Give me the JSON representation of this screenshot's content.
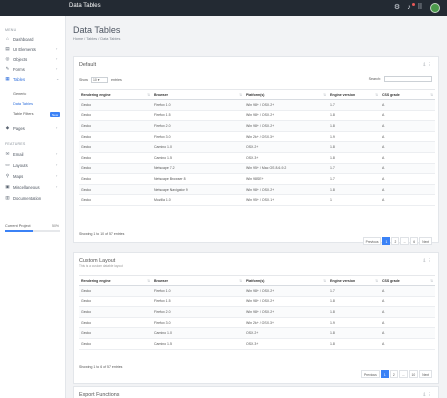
{
  "app": {
    "title": "Data Tables"
  },
  "topbar": {
    "icons": [
      "gear-icon",
      "bell-icon",
      "grid-icon"
    ]
  },
  "sidebar": {
    "section_main": "MENU",
    "items": [
      {
        "label": "Dashboard",
        "icon": "home-icon",
        "chevron": false
      },
      {
        "label": "UI Elements",
        "icon": "layers-icon",
        "chevron": true
      },
      {
        "label": "Objects",
        "icon": "circle-icon",
        "chevron": true
      },
      {
        "label": "Forms",
        "icon": "edit-icon",
        "chevron": true
      },
      {
        "label": "Tables",
        "icon": "table-icon",
        "chevron": true,
        "active": true
      }
    ],
    "tables_sub": [
      {
        "label": "Generic"
      },
      {
        "label": "Data Tables",
        "active": true
      },
      {
        "label": "Table Filters",
        "badge": "New"
      }
    ],
    "pages": {
      "label": "Pages",
      "icon": "file-icon"
    },
    "section_features": "FEATURES",
    "feature_items": [
      {
        "label": "Email",
        "icon": "mail-icon"
      },
      {
        "label": "Layouts",
        "icon": "layout-icon"
      },
      {
        "label": "Maps",
        "icon": "map-pin-icon"
      },
      {
        "label": "Miscellaneous",
        "icon": "box-icon"
      },
      {
        "label": "Documentation",
        "icon": "book-icon"
      }
    ],
    "project": {
      "label": "Current Project",
      "percent_text": "50%",
      "progress": 0.5
    }
  },
  "page": {
    "title": "Data Tables",
    "breadcrumb": "Home / Tables / Data Tables"
  },
  "default_card": {
    "title": "Default",
    "show_label": "Show",
    "entries_value": "10",
    "entries_label": "entries",
    "search_label": "Search:",
    "columns": [
      "Rendering engine",
      "Browser",
      "Platform(s)",
      "Engine version",
      "CSS grade"
    ],
    "rows": [
      [
        "Gecko",
        "Firefox 1.0",
        "Win 98+ / OSX.2+",
        "1.7",
        "A"
      ],
      [
        "Gecko",
        "Firefox 1.5",
        "Win 98+ / OSX.2+",
        "1.8",
        "A"
      ],
      [
        "Gecko",
        "Firefox 2.0",
        "Win 98+ / OSX.2+",
        "1.8",
        "A"
      ],
      [
        "Gecko",
        "Firefox 3.0",
        "Win 2k+ / OSX.3+",
        "1.9",
        "A"
      ],
      [
        "Gecko",
        "Camino 1.0",
        "OSX.2+",
        "1.8",
        "A"
      ],
      [
        "Gecko",
        "Camino 1.5",
        "OSX.3+",
        "1.8",
        "A"
      ],
      [
        "Gecko",
        "Netscape 7.2",
        "Win 95+ / Mac OS 8.6-9.2",
        "1.7",
        "A"
      ],
      [
        "Gecko",
        "Netscape Browser 8",
        "Win 98SE+",
        "1.7",
        "A"
      ],
      [
        "Gecko",
        "Netscape Navigator 9",
        "Win 98+ / OSX.2+",
        "1.8",
        "A"
      ],
      [
        "Gecko",
        "Mozilla 1.0",
        "Win 95+ / OSX.1+",
        "1",
        "A"
      ]
    ],
    "info": "Showing 1 to 10 of 57 entries",
    "pager": [
      "Previous",
      "1",
      "2",
      "...",
      "6",
      "Next"
    ]
  },
  "custom_card": {
    "title": "Custom Layout",
    "subtitle": "This is a custom datable layout",
    "columns": [
      "Rendering engine",
      "Browser",
      "Platform(s)",
      "Engine version",
      "CSS grade"
    ],
    "rows": [
      [
        "Gecko",
        "Firefox 1.0",
        "Win 98+ / OSX.2+",
        "1.7",
        "A"
      ],
      [
        "Gecko",
        "Firefox 1.5",
        "Win 98+ / OSX.2+",
        "1.8",
        "A"
      ],
      [
        "Gecko",
        "Firefox 2.0",
        "Win 98+ / OSX.2+",
        "1.8",
        "A"
      ],
      [
        "Gecko",
        "Firefox 3.0",
        "Win 2k+ / OSX.3+",
        "1.9",
        "A"
      ],
      [
        "Gecko",
        "Camino 1.0",
        "OSX.2+",
        "1.8",
        "A"
      ],
      [
        "Gecko",
        "Camino 1.5",
        "OSX.3+",
        "1.8",
        "A"
      ]
    ],
    "info": "Showing 1 to 6 of 57 entries",
    "pager": [
      "Previous",
      "1",
      "2",
      "...",
      "10",
      "Next"
    ]
  },
  "export_card": {
    "title": "Export Functions"
  },
  "card_tools": "⇩ ⋮",
  "sort_glyph": "⇅"
}
